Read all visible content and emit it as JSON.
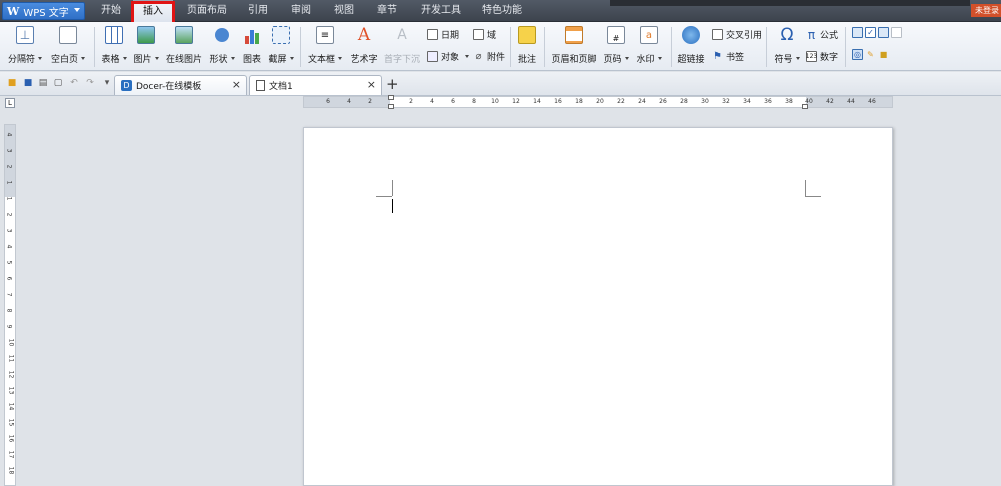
{
  "app": {
    "name": "WPS 文字",
    "logo_glyph": "W",
    "brand_color": "#2f6fc6"
  },
  "menu": {
    "tabs": [
      "开始",
      "插入",
      "页面布局",
      "引用",
      "审阅",
      "视图",
      "章节",
      "开发工具",
      "特色功能"
    ],
    "active": "插入",
    "right_badge": "未登录"
  },
  "ribbon": {
    "page_break": "分隔符",
    "blank_page": "空白页",
    "table": "表格",
    "picture": "图片",
    "online_picture": "在线图片",
    "shape": "形状",
    "chart": "图表",
    "screenshot": "截屏",
    "textbox": "文本框",
    "wordart": "艺术字",
    "drop_cap": "首字下沉",
    "date": "日期",
    "object": "对象",
    "field": "域",
    "attachment": "附件",
    "comment": "批注",
    "header_footer": "页眉和页脚",
    "page_number": "页码",
    "watermark": "水印",
    "hyperlink": "超链接",
    "cross_reference": "交叉引用",
    "bookmark": "书签",
    "symbol": "符号",
    "formula": "公式",
    "number": "数字"
  },
  "tabs": [
    {
      "label": "Docer-在线模板",
      "icon": "docer-icon"
    },
    {
      "label": "文档1",
      "icon": "document-icon"
    }
  ],
  "ruler": {
    "h_ticks": [
      "6",
      "4",
      "2",
      "2",
      "4",
      "6",
      "8",
      "10",
      "12",
      "14",
      "16",
      "18",
      "20",
      "22",
      "24",
      "26",
      "28",
      "30",
      "32",
      "34",
      "36",
      "38",
      "40",
      "42",
      "44",
      "46"
    ],
    "v_ticks": [
      "4",
      "3",
      "2",
      "1",
      "1",
      "2",
      "3",
      "4",
      "5",
      "6",
      "7",
      "8",
      "9",
      "10",
      "11",
      "12",
      "13",
      "14",
      "15",
      "16",
      "17",
      "18"
    ],
    "corner_label": "L"
  }
}
